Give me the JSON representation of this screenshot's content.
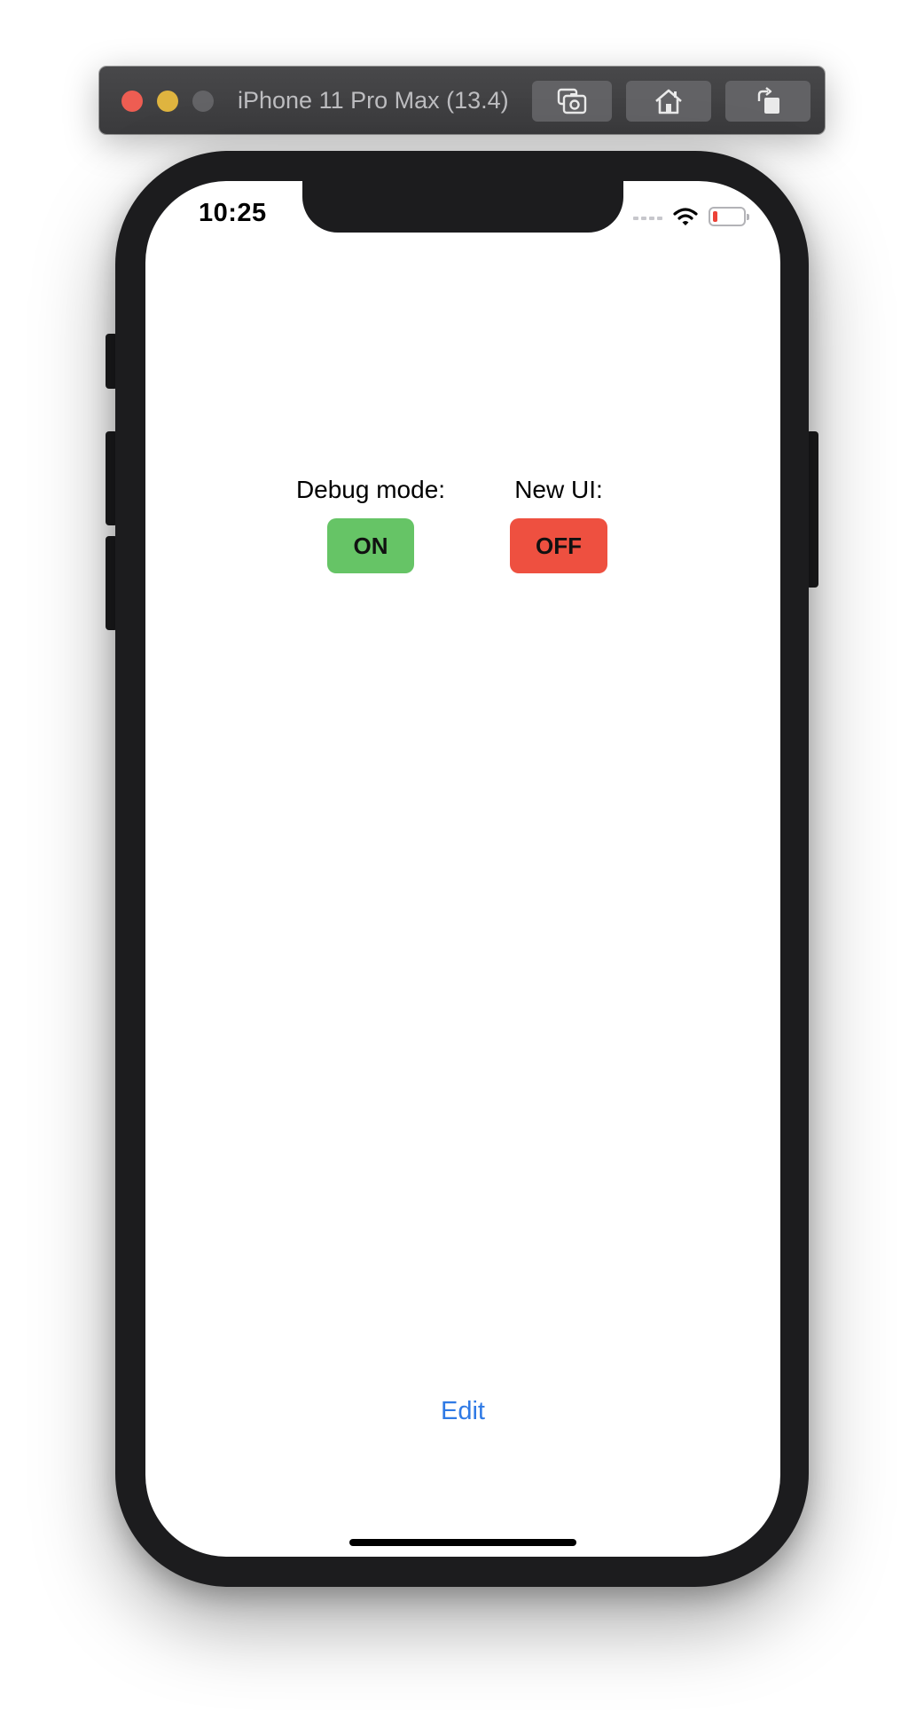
{
  "simulator": {
    "title": "iPhone 11 Pro Max (13.4)",
    "toolbar_buttons": [
      "screenshot-icon",
      "home-icon",
      "rotate-icon"
    ]
  },
  "status_bar": {
    "time": "10:25",
    "battery_level": 0.15,
    "battery_color": "#ec4237"
  },
  "settings": {
    "debug": {
      "label": "Debug mode:",
      "value": "ON",
      "color": "#66c466"
    },
    "new_ui": {
      "label": "New UI:",
      "value": "OFF",
      "color": "#ee5040"
    }
  },
  "footer": {
    "edit_label": "Edit"
  },
  "colors": {
    "link": "#2f7ae5",
    "device": "#1c1c1e"
  }
}
